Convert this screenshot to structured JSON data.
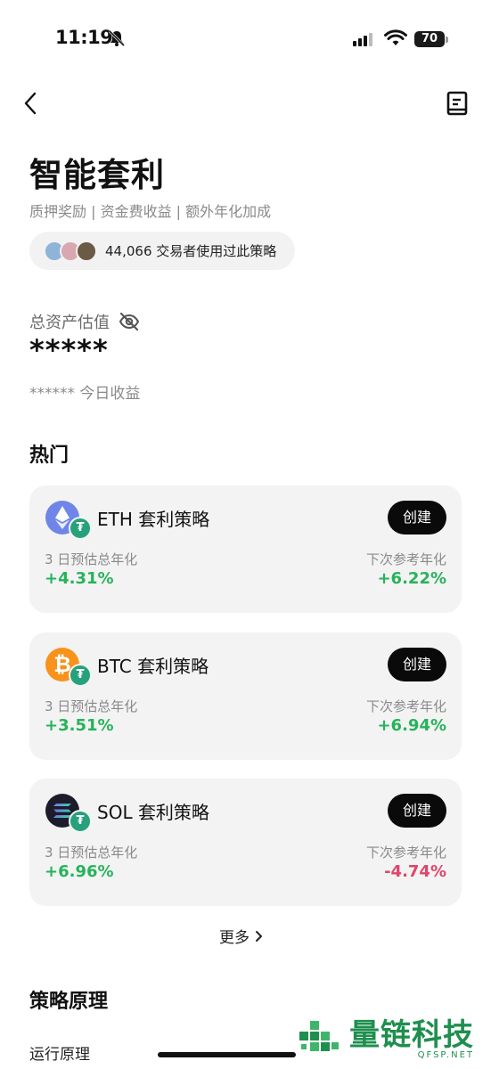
{
  "status_bar": {
    "time": "11:19",
    "battery": "70"
  },
  "header": {
    "title": "智能套利",
    "subtitle": "质押奖励 | 资金费收益 | 额外年化加成"
  },
  "users": {
    "text": "44,066 交易者使用过此策略"
  },
  "assets": {
    "label": "总资产估值",
    "value": "*****",
    "today_masked": "******",
    "today_label": "今日收益"
  },
  "hot": {
    "title": "热门",
    "create_label": "创建",
    "left_label": "3 日预估总年化",
    "right_label": "下次参考年化",
    "strategies": [
      {
        "name": "ETH 套利策略",
        "left_value": "+4.31%",
        "right_value": "+6.22%",
        "coin": "ethereum-icon"
      },
      {
        "name": "BTC 套利策略",
        "left_value": "+3.51%",
        "right_value": "+6.94%",
        "coin": "bitcoin-icon"
      },
      {
        "name": "SOL 套利策略",
        "left_value": "+6.96%",
        "right_value": "-4.74%",
        "coin": "solana-icon"
      }
    ]
  },
  "more": {
    "label": "更多"
  },
  "principle": {
    "title": "策略原理",
    "item": "运行原理"
  },
  "watermark": {
    "text": "量链科技",
    "sub": "QFSP.NET"
  },
  "colors": {
    "positive": "#26b35a",
    "negative": "#e0456b",
    "card_bg": "#f3f3f3"
  }
}
